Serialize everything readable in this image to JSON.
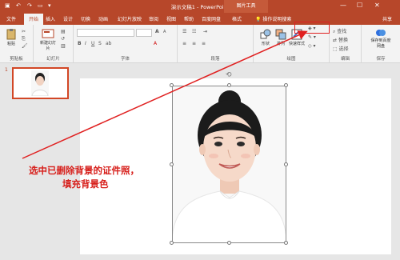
{
  "titlebar": {
    "title": "演示文稿1 - PowerPoint",
    "context_tab": "图片工具",
    "window_controls": [
      "—",
      "☐",
      "✕"
    ]
  },
  "tabs": [
    "文件",
    "开始",
    "插入",
    "设计",
    "切换",
    "动画",
    "幻灯片放映",
    "审阅",
    "视图",
    "帮助",
    "百度网盘",
    "格式"
  ],
  "active_tab": "开始",
  "tell_me": "操作说明搜索",
  "share": "共享",
  "ribbon": {
    "groups": [
      "剪贴板",
      "幻灯片",
      "字体",
      "段落",
      "绘图",
      "编辑"
    ],
    "paste": "粘贴",
    "new_slide": "新建幻灯片",
    "shape": "形状",
    "arrange": "排列",
    "quick_styles": "快速样式",
    "find": "查找",
    "replace": "替换",
    "select": "选择",
    "save_baidu": "保存到百度网盘",
    "save_label_group": "保存"
  },
  "slide_number": "1",
  "annotation": {
    "line1": "选中已删除背景的证件照，",
    "line2": "填充背景色"
  },
  "colors": {
    "accent": "#b7472a",
    "annotation": "#d7201c"
  }
}
